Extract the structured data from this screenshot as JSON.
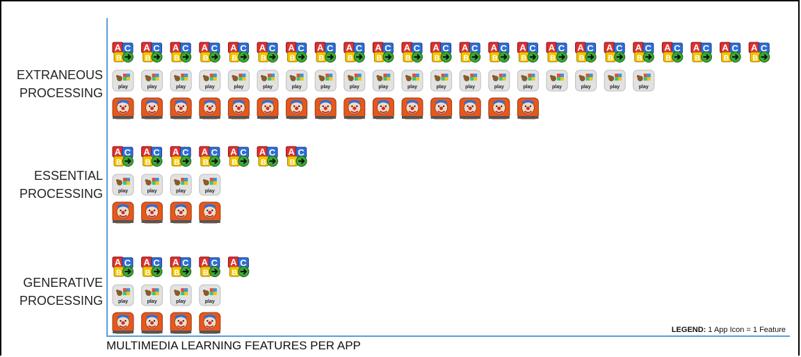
{
  "chart_data": {
    "type": "bar",
    "orientation": "horizontal",
    "xlabel": "MULTIMEDIA LEARNING FEATURES PER APP",
    "legend_note": {
      "bold": "LEGEND:",
      "text": " 1 App Icon =  1 Feature",
      "placement": "bottom-right"
    },
    "categories": [
      {
        "line1": "EXTRANEOUS",
        "line2": "PROCESSING"
      },
      {
        "line1": "ESSENTIAL",
        "line2": "PROCESSING"
      },
      {
        "line1": "GENERATIVE",
        "line2": "PROCESSING"
      }
    ],
    "series": [
      {
        "icon": "abc-blocks-app-icon",
        "values": [
          23,
          7,
          5
        ]
      },
      {
        "icon": "puzzle-play-app-icon",
        "values": [
          19,
          4,
          4
        ]
      },
      {
        "icon": "clown-app-icon",
        "values": [
          15,
          4,
          4
        ]
      }
    ],
    "grid": false
  },
  "colors": {
    "axis": "#5b9bd5",
    "abc_red": "#e03030",
    "abc_blue": "#2f6fd6",
    "abc_yellow": "#f5c400",
    "abc_green": "#3aa935",
    "clown_orange": "#e8571c"
  }
}
